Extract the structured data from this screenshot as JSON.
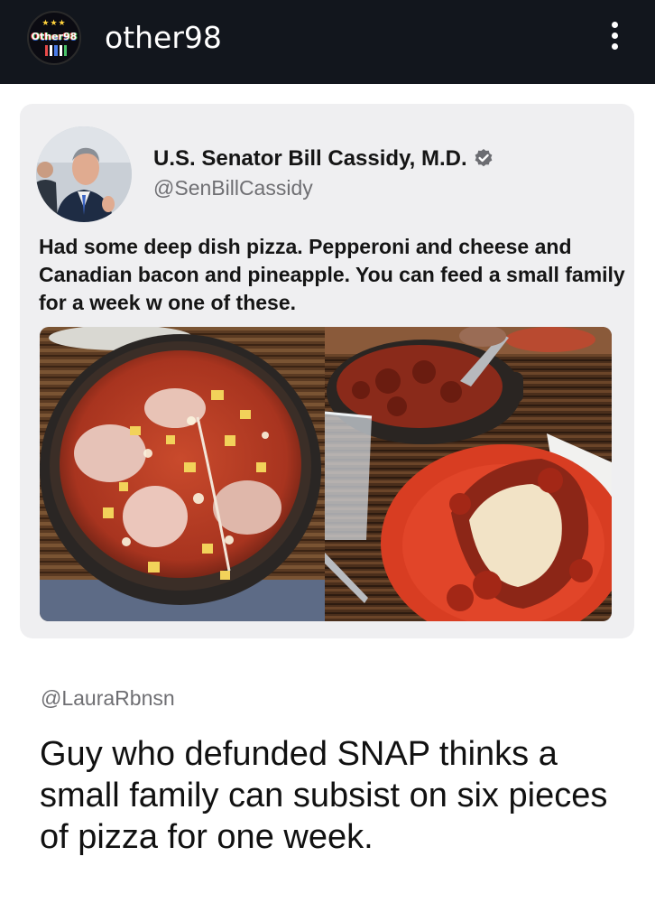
{
  "header": {
    "username": "other98",
    "badge_text": "Other98",
    "badge_stars": "★★★"
  },
  "tweet": {
    "display_name": "U.S. Senator Bill Cassidy, M.D.",
    "handle": "@SenBillCassidy",
    "verified": true,
    "text": "Had some deep dish pizza. Pepperoni and cheese and Canadian bacon and pineapple. You can feed a small family for a week w one of these.",
    "photos": [
      "pizza-in-skillet-photo",
      "pizza-slice-on-plate-photo"
    ]
  },
  "reply": {
    "handle": "@LauraRbnsn",
    "text": "Guy who defunded SNAP thinks a small family can subsist on six pieces of pizza for one week."
  },
  "colors": {
    "topbar": "#12161d",
    "card_bg": "#efeff1",
    "verified_badge": "#6c6d72",
    "muted_text": "#6f6f73"
  },
  "icons": [
    "more-options-icon",
    "verified-icon"
  ]
}
